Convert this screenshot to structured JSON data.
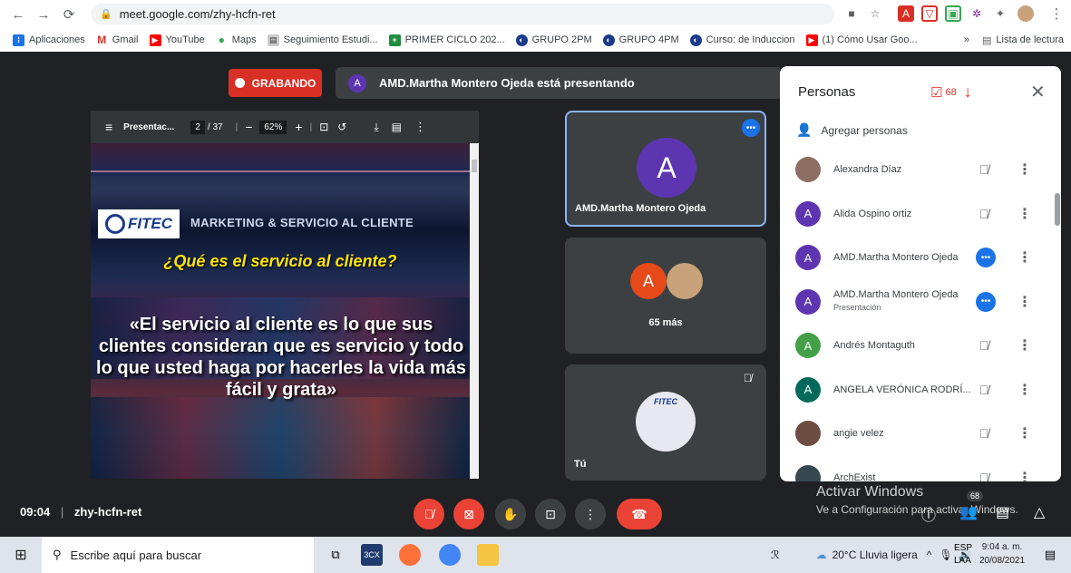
{
  "browser": {
    "url": "meet.google.com/zhy-hcfn-ret",
    "bookmarks": [
      "Aplicaciones",
      "Gmail",
      "YouTube",
      "Maps",
      "Seguimiento Estudi...",
      "PRIMER CICLO 202...",
      "GRUPO 2PM",
      "GRUPO 4PM",
      "Curso: de Induccion",
      "(1) Cómo Usar Goo..."
    ],
    "bookmarks_more": "»",
    "reading_list": "Lista de lectura"
  },
  "meet": {
    "recording_label": "GRABANDO",
    "presenting_initial": "A",
    "presenting_text": "AMD.Martha Montero Ojeda está presentando",
    "pdf": {
      "title": "Presentac...",
      "page": "2",
      "pages": "/ 37",
      "zoom": "62%"
    },
    "slide": {
      "logo_text": "FITEC",
      "header": "MARKETING & SERVICIO AL CLIENTE",
      "question": "¿Qué es el servicio al cliente?",
      "quote": "«El servicio al cliente es lo que sus clientes consideran que es servicio y todo lo que usted haga por hacerles la vida más fácil y grata»"
    },
    "tiles": {
      "main_initial": "A",
      "main_name": "AMD.Martha Montero Ojeda",
      "group_initial": "A",
      "group_more": "65 más",
      "self_label": "Tú",
      "self_badge": "FITEC"
    },
    "clock": "09:04",
    "meeting_code": "zhy-hcfn-ret",
    "activate_title": "Activar Windows",
    "activate_sub": "Ve a Configuración para activar Windows.",
    "people_count": "68"
  },
  "panel": {
    "title": "Personas",
    "badge_count": "68",
    "add_people": "Agregar personas",
    "people": [
      {
        "name": "Alexandra Díaz",
        "sub": "",
        "initial": "",
        "color": "#8d6e63",
        "mic": "muted"
      },
      {
        "name": "Alida Ospino ortiz",
        "sub": "",
        "initial": "A",
        "color": "#5e35b1",
        "mic": "muted"
      },
      {
        "name": "AMD.Martha Montero Ojeda",
        "sub": "",
        "initial": "A",
        "color": "#5e35b1",
        "mic": "active"
      },
      {
        "name": "AMD.Martha Montero Ojeda",
        "sub": "Presentación",
        "initial": "A",
        "color": "#5e35b1",
        "mic": "active"
      },
      {
        "name": "Andrés Montaguth",
        "sub": "",
        "initial": "A",
        "color": "#43a047",
        "mic": "muted"
      },
      {
        "name": "ANGELA VERÓNICA RODRÍ...",
        "sub": "",
        "initial": "A",
        "color": "#00695c",
        "mic": "muted"
      },
      {
        "name": "angie velez",
        "sub": "",
        "initial": "",
        "color": "#6d4c41",
        "mic": "muted"
      },
      {
        "name": "ArchExist",
        "sub": "",
        "initial": "",
        "color": "#37474f",
        "mic": "muted"
      }
    ]
  },
  "taskbar": {
    "search_placeholder": "Escribe aquí para buscar",
    "weather": "20°C Lluvia ligera",
    "lang1": "ESP",
    "lang2": "LAA",
    "time": "9:04 a. m.",
    "date": "20/08/2021"
  },
  "colors": {
    "recording": "#d93025",
    "accent": "#1a73e8",
    "meet_bg": "#202124",
    "tile": "#3c4043",
    "avatar_purple": "#5e35b1"
  }
}
